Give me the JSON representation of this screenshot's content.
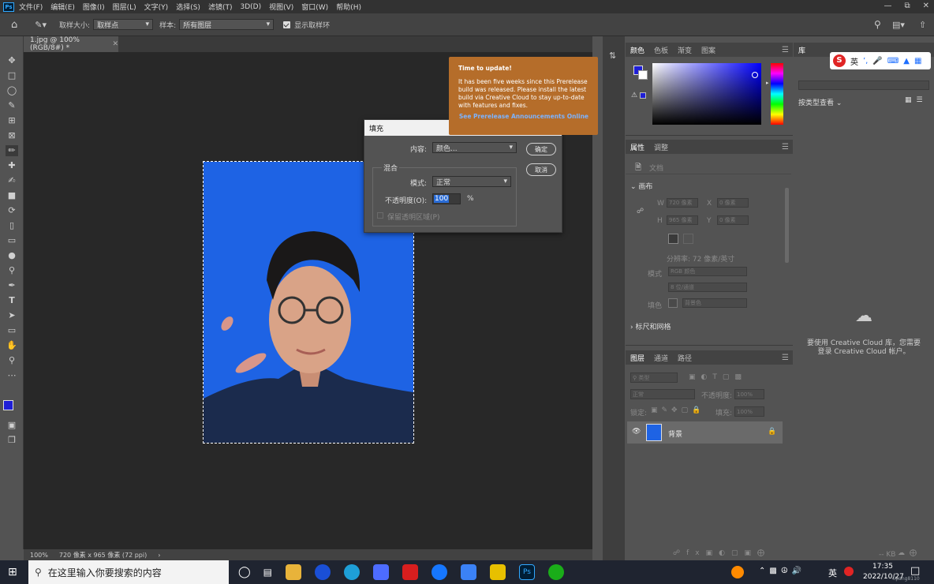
{
  "menubar": {
    "logo": "Ps",
    "items": [
      "文件(F)",
      "编辑(E)",
      "图像(I)",
      "图层(L)",
      "文字(Y)",
      "选择(S)",
      "滤镜(T)",
      "3D(D)",
      "视图(V)",
      "窗口(W)",
      "帮助(H)"
    ]
  },
  "options": {
    "sample_size_label": "取样大小:",
    "sample_size_value": "取样点",
    "sample_label": "样本:",
    "sample_value": "所有图层",
    "show_ring_label": "显示取样环"
  },
  "document": {
    "tab_title": "1.jpg @ 100%(RGB/8#) *",
    "zoom": "100%",
    "info": "720 像素 x 965 像素 (72 ppi)"
  },
  "dialog": {
    "title": "填充",
    "content_label": "内容:",
    "content_value": "颜色...",
    "ok": "确定",
    "cancel": "取消",
    "blend_group": "混合",
    "mode_label": "模式:",
    "mode_value": "正常",
    "opacity_label": "不透明度(O):",
    "opacity_value": "100",
    "opacity_unit": "%",
    "preserve_label": "保留透明区域(P)"
  },
  "update_tip": {
    "title": "Time to update!",
    "body": "It has been five weeks since this Prerelease build was released. Please install the latest build via Creative Cloud to stay up-to-date with features and fixes.",
    "link": "See Prerelease Announcements Online"
  },
  "color_panel": {
    "tabs": [
      "颜色",
      "色板",
      "渐变",
      "图案"
    ],
    "foreground": "#1f1fd6",
    "background": "#ffffff"
  },
  "properties_panel": {
    "tabs": [
      "属性",
      "调整"
    ],
    "doc_label": "文档",
    "canvas_section": "画布",
    "w_label": "W",
    "w_value": "720 像素",
    "x_label": "X",
    "x_value": "0 像素",
    "h_label": "H",
    "h_value": "965 像素",
    "y_label": "Y",
    "y_value": "0 像素",
    "resolution": "分辨率: 72 像素/英寸",
    "mode_label": "模式",
    "mode_value": "RGB 颜色",
    "bits_value": "8 位/通道",
    "fill_label": "填色",
    "fill_value": "背景色",
    "rulers_section": "标尺和网格"
  },
  "layers_panel": {
    "tabs": [
      "图层",
      "通道",
      "路径"
    ],
    "filter_label": "类型",
    "blend_mode": "正常",
    "opacity_label": "不透明度:",
    "opacity_value": "100%",
    "lock_label": "锁定:",
    "fill_label": "填充:",
    "fill_value": "100%",
    "layer_name": "背景"
  },
  "library": {
    "tab": "库",
    "view_label": "按类型查看",
    "cc_message": "要使用 Creative Cloud 库，您需要登录 Creative Cloud 帐户。",
    "size": "-- KB",
    "ime": "英"
  },
  "taskbar": {
    "search_placeholder": "在这里输入你要搜索的内容",
    "time": "17:35",
    "date": "2022/10/27",
    "ime": "英",
    "user": "lipang8110"
  }
}
